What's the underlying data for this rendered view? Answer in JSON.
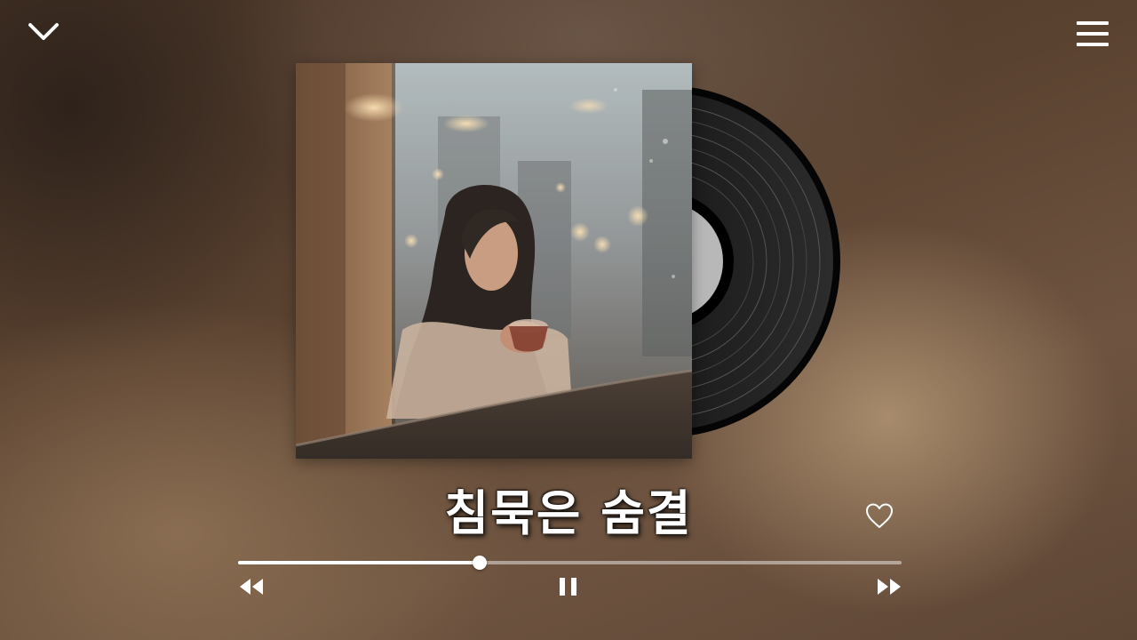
{
  "player": {
    "song_title": "침묵은 숨결",
    "progress": 0.364,
    "is_playing": true,
    "liked": false
  },
  "icons": {
    "collapse": "chevron-down-icon",
    "menu": "hamburger-menu-icon",
    "like": "heart-outline-icon",
    "rewind": "rewind-icon",
    "pause": "pause-icon",
    "forward": "fast-forward-icon"
  },
  "colors": {
    "foreground": "#ffffff",
    "track_background": "rgba(255,255,255,0.45)"
  }
}
